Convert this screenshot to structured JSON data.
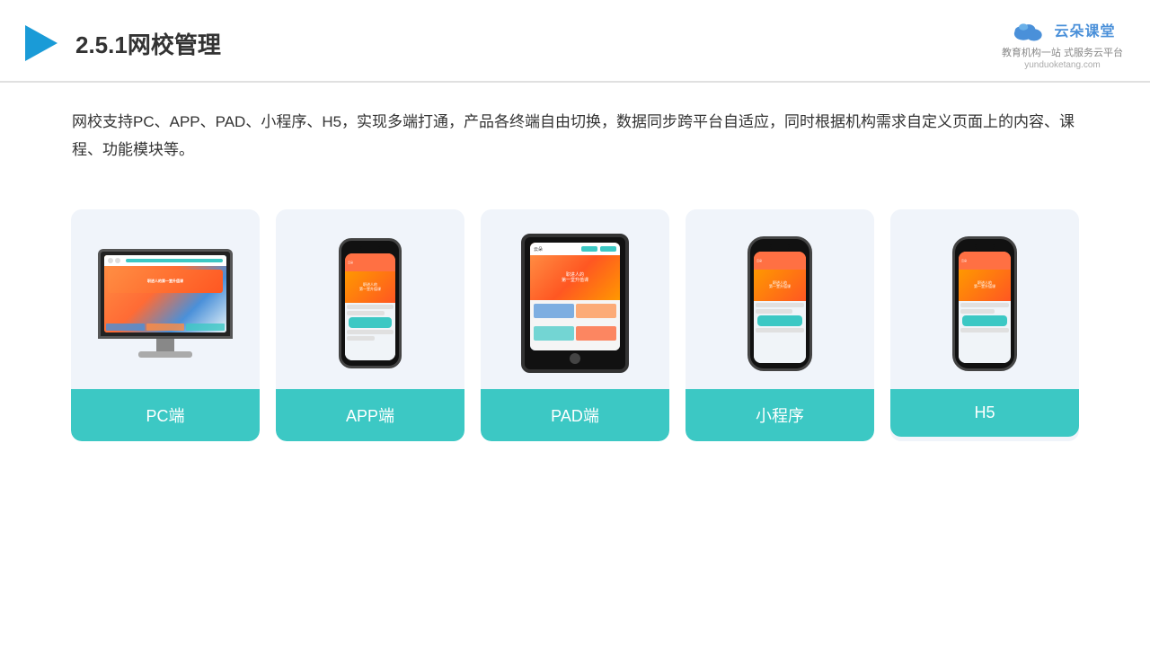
{
  "header": {
    "title": "2.5.1网校管理",
    "logo_main": "云朵课堂",
    "logo_url": "yunduoketang.com",
    "logo_sub": "教育机构一站\n式服务云平台"
  },
  "description": {
    "text": "网校支持PC、APP、PAD、小程序、H5，实现多端打通，产品各终端自由切换，数据同步跨平台自适应，同时根据机构需求自定义页面上的内容、课程、功能模块等。"
  },
  "cards": [
    {
      "id": "pc",
      "label": "PC端"
    },
    {
      "id": "app",
      "label": "APP端"
    },
    {
      "id": "pad",
      "label": "PAD端"
    },
    {
      "id": "miniapp",
      "label": "小程序"
    },
    {
      "id": "h5",
      "label": "H5"
    }
  ],
  "colors": {
    "teal": "#3cc8c4",
    "accent_orange": "#ff8c42",
    "accent_blue": "#4a90d9",
    "text_dark": "#333333",
    "bg_card": "#f0f4fa"
  }
}
